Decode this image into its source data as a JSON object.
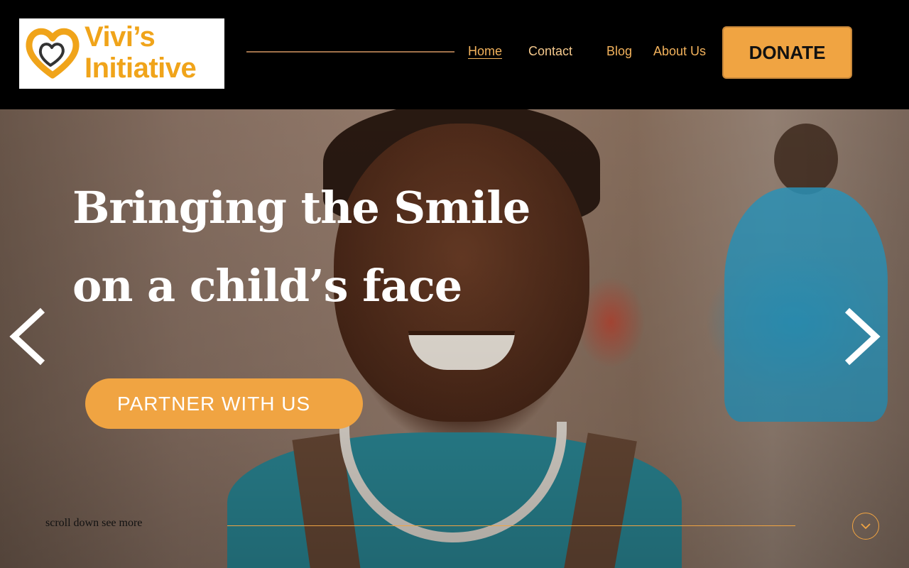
{
  "logo": {
    "line1": "Vivi’s",
    "line2": "Initiative",
    "color": "#f0a41a"
  },
  "nav": {
    "home": "Home",
    "contact": "Contact",
    "blog": "Blog",
    "about": "About Us"
  },
  "donate_label": "DONATE",
  "hero": {
    "headline_line1": "Bringing the Smile",
    "headline_line2": "on a child’s face",
    "cta_label": "PARTNER WITH US",
    "scroll_text": "scroll down see more"
  },
  "colors": {
    "accent": "#f0a442",
    "header_bg": "#000000"
  },
  "icons": {
    "prev": "chevron-left-icon",
    "next": "chevron-right-icon",
    "scroll": "chevron-down-icon"
  }
}
